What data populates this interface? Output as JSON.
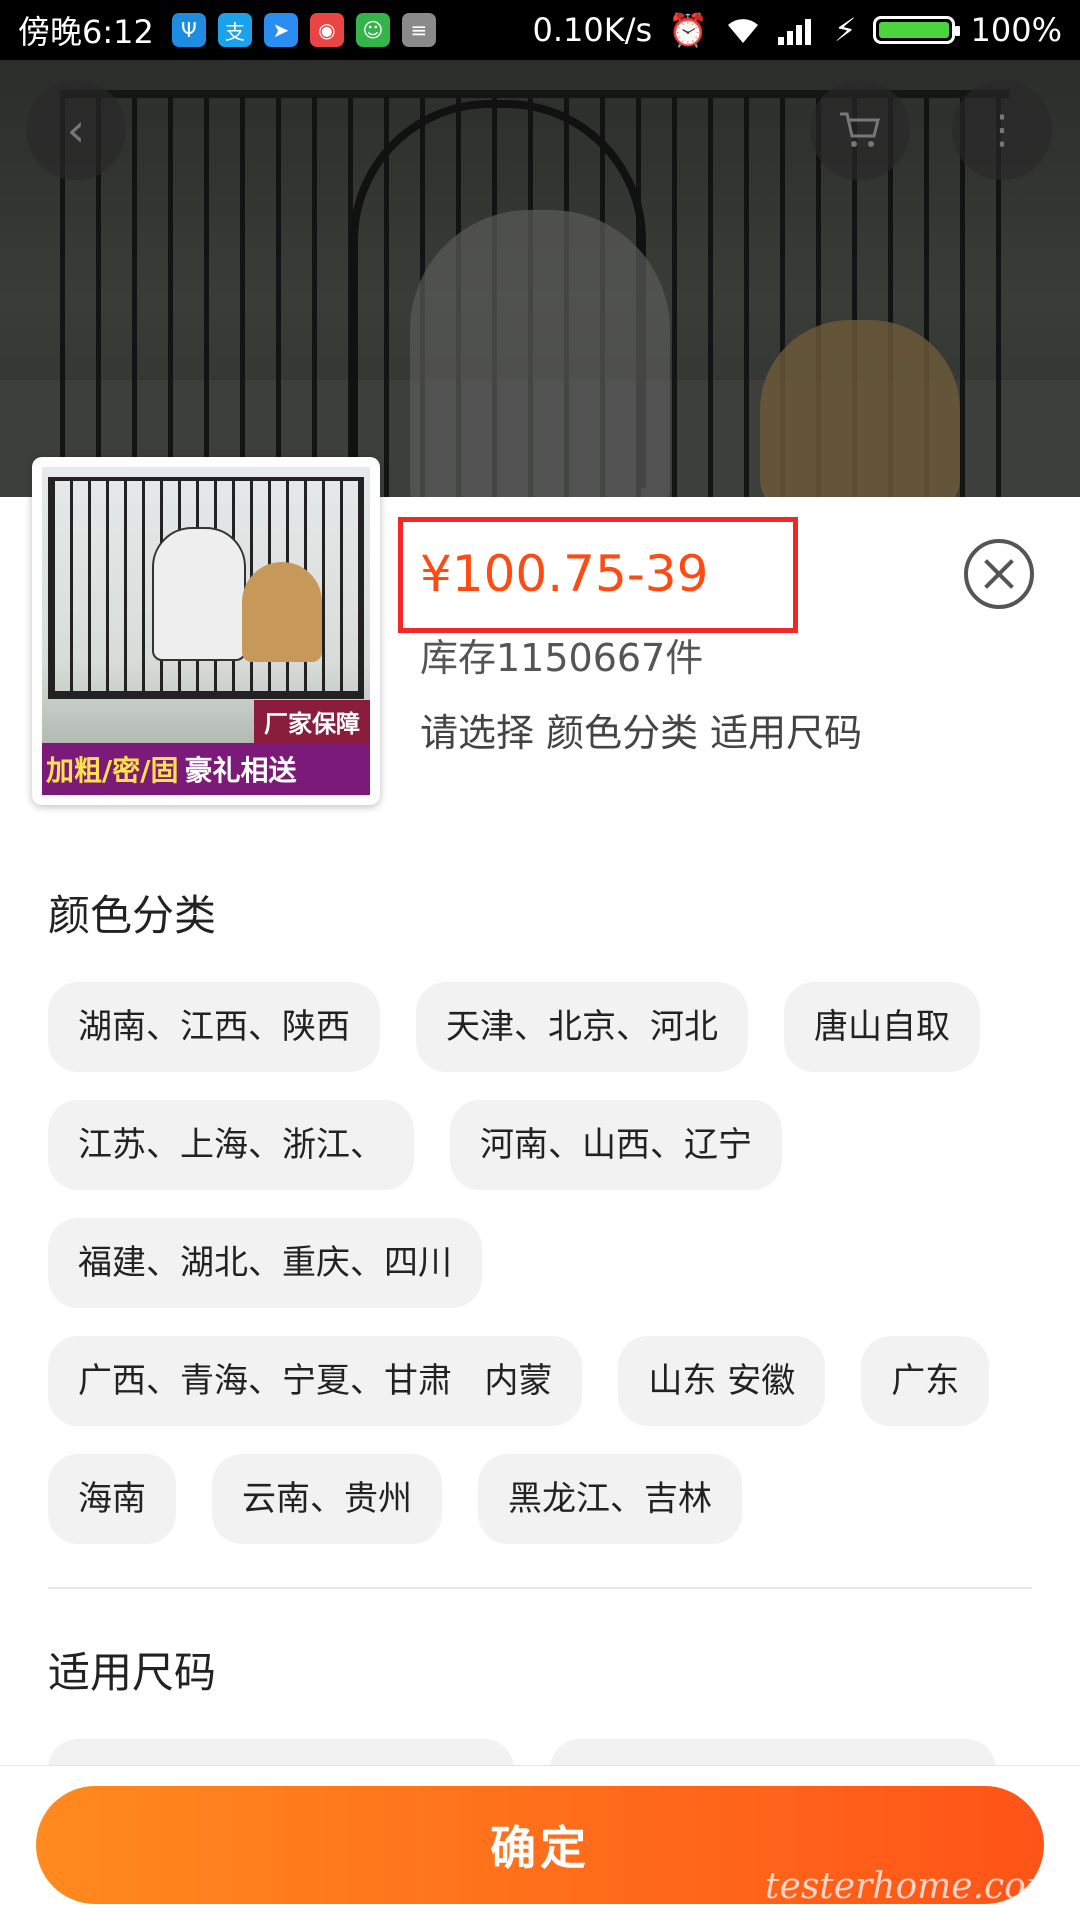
{
  "status_bar": {
    "time": "傍晚6:12",
    "network_speed": "0.10K/s",
    "battery": "100%",
    "app_icons": [
      "usb-icon",
      "alipay-icon",
      "message-icon",
      "app-icon-red",
      "app-icon-green",
      "app-icon-gray"
    ]
  },
  "header": {
    "back_icon": "chevron-left-icon",
    "cart_icon": "cart-icon",
    "more_icon": "more-vertical-icon"
  },
  "product": {
    "thumbnail_banner_top": "厂家保障",
    "thumbnail_banner_left": "加粗/密/固",
    "thumbnail_banner_right": "豪礼相送",
    "price": "¥100.75-39",
    "stock": "库存1150667件",
    "select_hint": "请选择 颜色分类 适用尺码"
  },
  "color_section": {
    "title": "颜色分类",
    "rows": [
      [
        "湖南、江西、陕西",
        "天津、北京、河北",
        "唐山自取"
      ],
      [
        "江苏、上海、浙江、",
        "河南、山西、辽宁"
      ],
      [
        "福建、湖北、重庆、四川"
      ],
      [
        "广西、青海、宁夏、甘肃   内蒙",
        "山东 安徽",
        "广东"
      ],
      [
        "海南",
        "云南、贵州",
        "黑龙江、吉林"
      ]
    ]
  },
  "size_section": {
    "title": "适用尺码"
  },
  "footer": {
    "confirm_label": "确定",
    "watermark": "testerhome.com"
  }
}
